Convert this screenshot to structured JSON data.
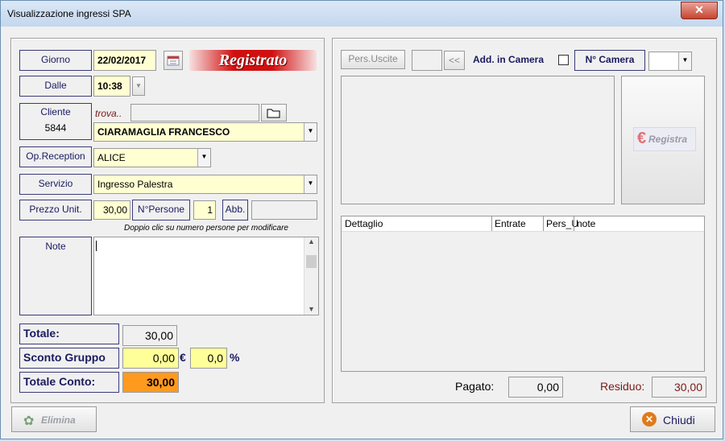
{
  "window": {
    "title": "Visualizzazione ingressi SPA",
    "close_glyph": "✕"
  },
  "left": {
    "giorno_label": "Giorno",
    "giorno_value": "22/02/2017",
    "calendar_icon": "calendar-icon",
    "stamp": "Registrato",
    "dalle_label": "Dalle",
    "dalle_value": "10:38",
    "cliente_label": "Cliente",
    "cliente_code": "5844",
    "trova": "trova..",
    "cliente_name": "CIARAMAGLIA FRANCESCO",
    "op_label": "Op.Reception",
    "op_value": "ALICE",
    "servizio_label": "Servizio",
    "servizio_value": "Ingresso Palestra",
    "prezzo_label": "Prezzo Unit.",
    "prezzo_value": "30,00",
    "npersone_label": "N°Persone",
    "npersone_value": "1",
    "abb_label": "Abb.",
    "hint": "Doppio clic su numero persone per modificare",
    "note_label": "Note",
    "totale_label": "Totale:",
    "totale_value": "30,00",
    "sconto_label": "Sconto Gruppo",
    "sconto_value": "0,00",
    "euro_sign": "€",
    "sconto_perc": "0,0",
    "perc_sign": "%",
    "totale_conto_label": "Totale Conto:",
    "totale_conto_value": "30,00"
  },
  "right": {
    "pers_uscite_label": "Pers.Uscite",
    "prev_glyph": "<<",
    "add_camera_label": "Add. in Camera",
    "ncamera_label": "N° Camera",
    "registra_label": "Registra",
    "table_headers": [
      "Dettaglio",
      "Entrate",
      "Pers_U",
      "note"
    ],
    "pagato_label": "Pagato:",
    "pagato_value": "0,00",
    "residuo_label": "Residuo:",
    "residuo_value": "30,00"
  },
  "footer": {
    "elimina_label": "Elimina",
    "chiudi_label": "Chiudi"
  },
  "colors": {
    "accent_orange": "#ff9a1e",
    "residuo_red": "#7a1a1a"
  }
}
